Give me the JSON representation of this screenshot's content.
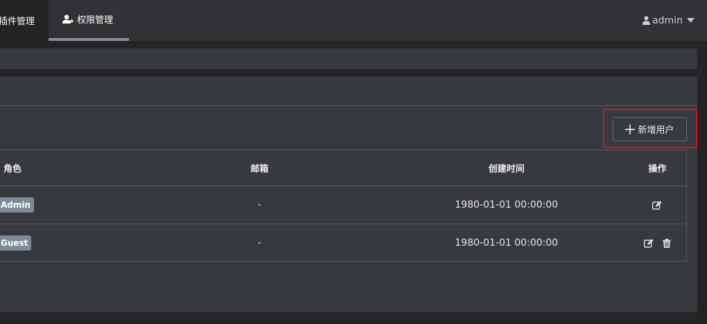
{
  "nav": {
    "tabs": [
      {
        "label": "插件管理",
        "active": true
      },
      {
        "label": "权限管理",
        "icon": "user-plus-icon"
      }
    ],
    "user": {
      "icon": "user-icon",
      "name": "admin",
      "caret": "caret-down-icon"
    }
  },
  "toolbar": {
    "add_user_label": "新增用户",
    "add_user_icon": "plus-icon"
  },
  "table": {
    "columns": [
      "角色",
      "邮箱",
      "创建时间",
      "操作"
    ],
    "rows": [
      {
        "role": "Admin",
        "email": "-",
        "created": "1980-01-01 00:00:00",
        "actions": [
          "edit-icon"
        ]
      },
      {
        "role": "Guest",
        "email": "-",
        "created": "1980-01-01 00:00:00",
        "actions": [
          "edit-icon",
          "trash-icon"
        ]
      }
    ]
  },
  "colors": {
    "background": "#222426",
    "topbar": "#303236",
    "panel": "#36393d",
    "badge": "#7d8a99",
    "highlight": "#d2141e"
  }
}
